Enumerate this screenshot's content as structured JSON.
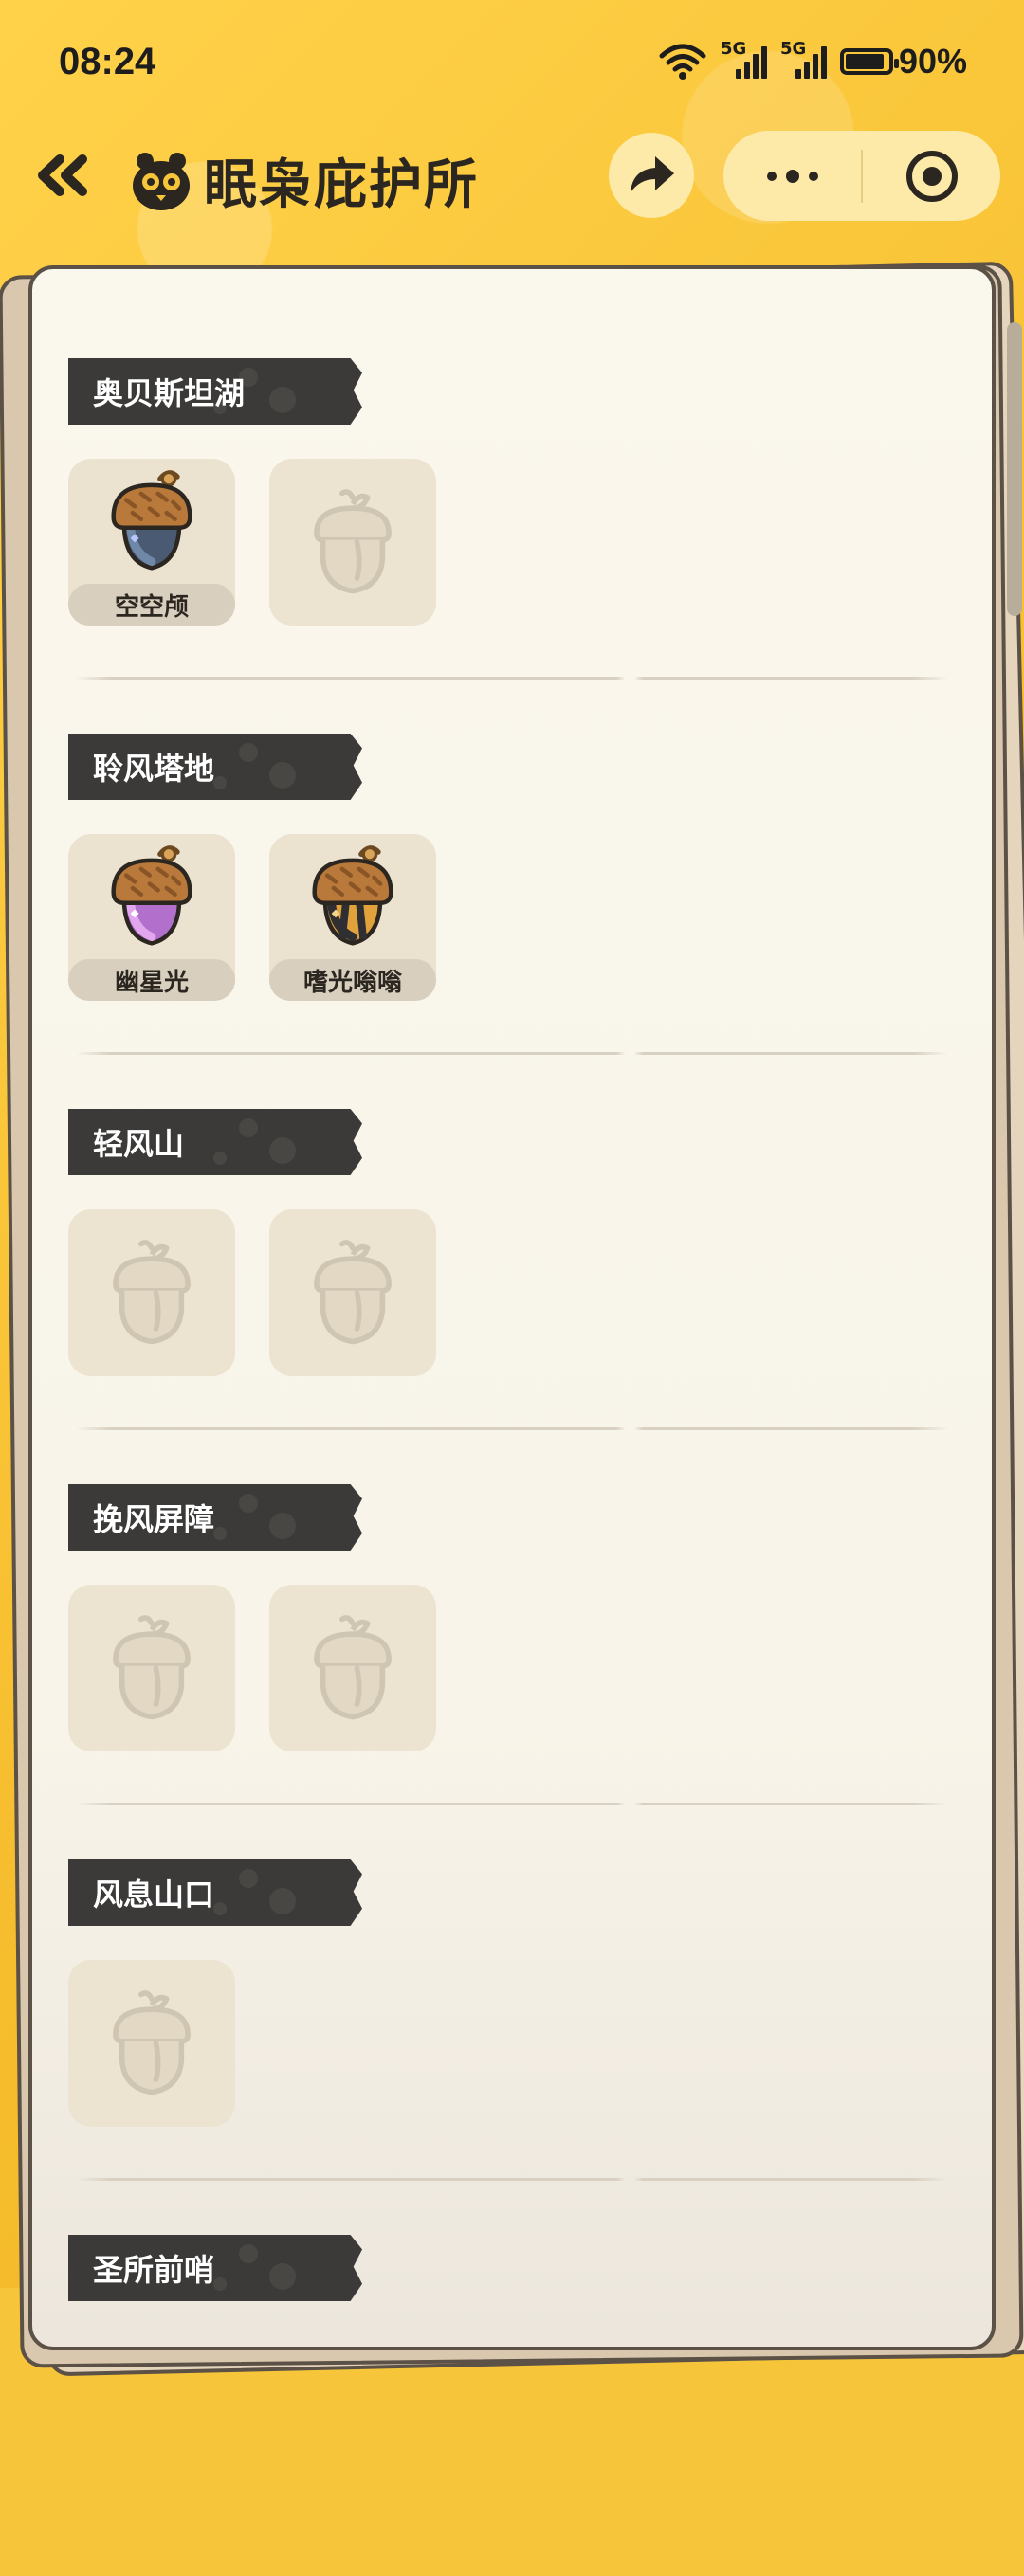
{
  "status_bar": {
    "time": "08:24",
    "network_1": "5G",
    "network_2": "5G",
    "battery": "90%",
    "battery_level": 0.9
  },
  "header": {
    "back_icon": "double-chevron-left-icon",
    "logo_icon": "mascot-logo-icon",
    "title": "眠枭庇护所",
    "share_icon": "share-arrow-icon",
    "more_icon": "more-dots-icon",
    "close_icon": "target-circle-icon"
  },
  "colors": {
    "background": "#f7c53a",
    "paper": "#faf7ed",
    "header_tag": "#3b3a38",
    "slot": "#ede3d1"
  },
  "sections": [
    {
      "name": "奥贝斯坦湖",
      "slots": [
        {
          "state": "filled",
          "label": "空空颅",
          "icon": "acorn-dark-blue-icon"
        },
        {
          "state": "empty",
          "label": "",
          "icon": "acorn-placeholder-icon"
        }
      ]
    },
    {
      "name": "聆风塔地",
      "slots": [
        {
          "state": "filled",
          "label": "幽星光",
          "icon": "acorn-purple-icon"
        },
        {
          "state": "filled",
          "label": "嗜光嗡嗡",
          "icon": "acorn-striped-icon"
        }
      ]
    },
    {
      "name": "轻风山",
      "slots": [
        {
          "state": "empty",
          "label": "",
          "icon": "acorn-placeholder-icon"
        },
        {
          "state": "empty",
          "label": "",
          "icon": "acorn-placeholder-icon"
        }
      ]
    },
    {
      "name": "挽风屏障",
      "slots": [
        {
          "state": "empty",
          "label": "",
          "icon": "acorn-placeholder-icon"
        },
        {
          "state": "empty",
          "label": "",
          "icon": "acorn-placeholder-icon"
        }
      ]
    },
    {
      "name": "风息山口",
      "slots": [
        {
          "state": "empty",
          "label": "",
          "icon": "acorn-placeholder-icon"
        }
      ]
    },
    {
      "name": "圣所前哨",
      "slots": []
    }
  ]
}
